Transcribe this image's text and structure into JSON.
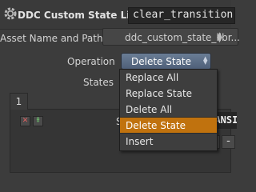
{
  "header": {
    "node_type": "DDC Custom State Library",
    "node_name": "clear_transition",
    "icon": "gear-icon"
  },
  "params": {
    "asset_label": "Asset Name and Path",
    "asset_value": "ddc_custom_state_libr...",
    "operation_label": "Operation",
    "operation_value": "Delete State",
    "states_label": "States",
    "tab_label": "1",
    "state_label_partial": "S",
    "state_name_partial": "TRANSITION"
  },
  "menu": {
    "items": [
      "Replace All",
      "Replace State",
      "Delete All",
      "Delete State",
      "Insert"
    ],
    "selected": "Delete State"
  },
  "buttons": {
    "plus": "+",
    "minus": "-"
  },
  "colors": {
    "accent": "#c0720e",
    "select_blue": "#5a6c86"
  }
}
